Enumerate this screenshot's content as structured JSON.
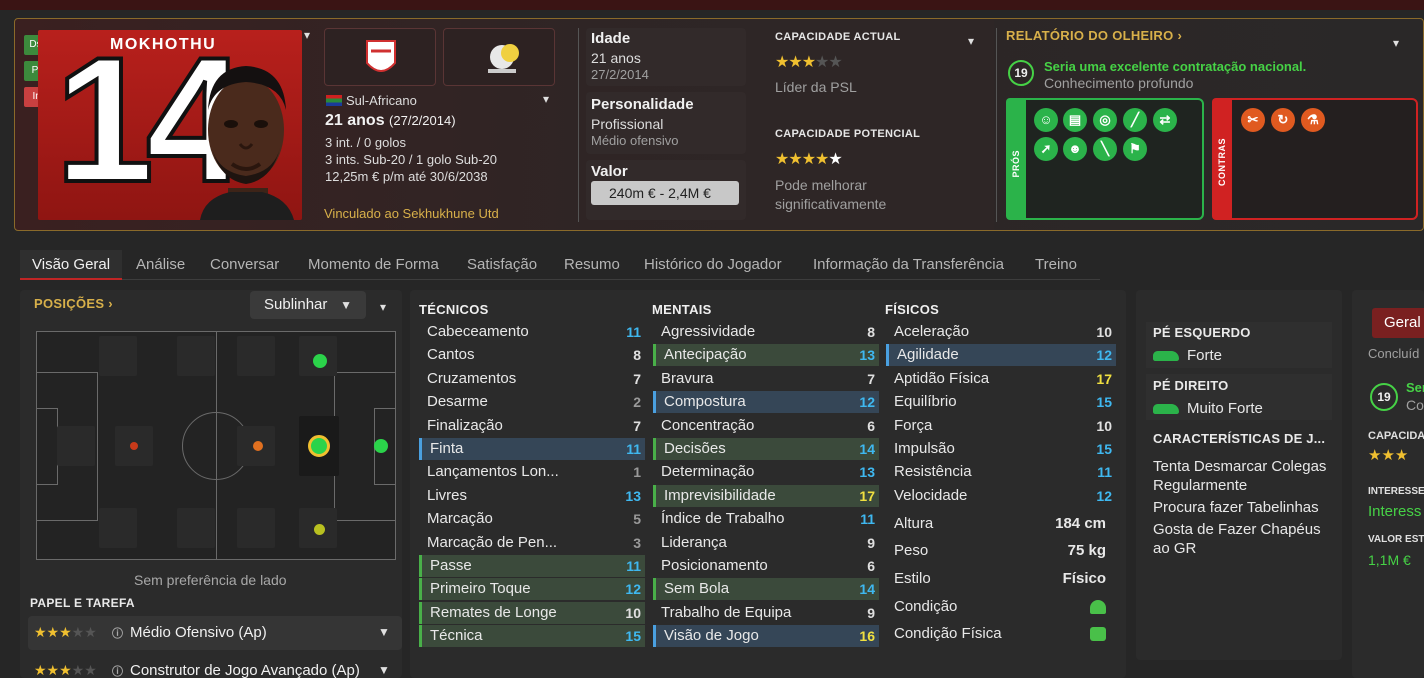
{
  "player": {
    "name": "MOKHOTHU",
    "number": "14",
    "nationality": "Sul-Africano",
    "age_bold": "21 anos",
    "dob_paren": "(27/2/2014)",
    "caps": "3 int. / 0 golos",
    "u20_caps": "3 ints. Sub-20 / 1 golo Sub-20",
    "contract": "12,25m € p/m até 30/6/2038",
    "club_link": "Vinculado ao Sekhukhune Utd"
  },
  "role_buttons": [
    {
      "label": "Dsc",
      "color": "#3c8a3c"
    },
    {
      "label": "Prt",
      "color": "#3c8a3c"
    },
    {
      "label": "Int",
      "color": "#c84040"
    }
  ],
  "info": {
    "age_label": "Idade",
    "age_value": "21 anos",
    "age_dob": "27/2/2014",
    "personality_label": "Personalidade",
    "personality_value": "Profissional",
    "personality_role": "Médio ofensivo",
    "value_label": "Valor",
    "value_range": "240m € - 2,4M €"
  },
  "ability": {
    "current_label": "CAPACIDADE ACTUAL",
    "current_stars": "★★★",
    "current_stars_empty": "★★",
    "current_note": "Líder da PSL",
    "potential_label": "CAPACIDADE POTENCIAL",
    "potential_stars": "★★★★",
    "potential_stars_white": "★",
    "potential_note": "Pode melhorar significativamente"
  },
  "scout": {
    "title": "RELATÓRIO DO OLHEIRO",
    "rating": "19",
    "headline": "Seria uma excelente contratação nacional.",
    "knowledge": "Conhecimento profundo",
    "pros_label": "PRÓS",
    "cons_label": "CONTRAS",
    "pros_icons": [
      "head-icon",
      "clipboard-icon",
      "target-icon",
      "boot-icon",
      "arrows-icon",
      "pass-icon",
      "smile-icon",
      "bandage-icon",
      "flag-icon"
    ],
    "cons_icons": [
      "scissors-icon",
      "curve-icon",
      "flask-icon"
    ]
  },
  "tabs": [
    "Visão Geral",
    "Análise",
    "Conversar",
    "Momento de Forma",
    "Satisfação",
    "Resumo",
    "Histórico do Jogador",
    "Informação da Transferência",
    "Treino"
  ],
  "positions": {
    "title": "POSIÇÕES",
    "dropdown": "Sublinhar",
    "side_pref": "Sem preferência de lado"
  },
  "role": {
    "title": "PAPEL E TAREFA",
    "items": [
      {
        "stars": "★★★",
        "empty": "★★",
        "label": "Médio Ofensivo (Ap)"
      },
      {
        "stars": "★★★",
        "empty": "★★",
        "label": "Construtor de Jogo Avançado (Ap)"
      }
    ]
  },
  "attributes": {
    "technical_title": "TÉCNICOS",
    "mental_title": "MENTAIS",
    "physical_title": "FÍSICOS",
    "technical": [
      {
        "name": "Cabeceamento",
        "value": "11",
        "color": "#3fb8f0",
        "hl": ""
      },
      {
        "name": "Cantos",
        "value": "8",
        "color": "#e0e0e0",
        "hl": ""
      },
      {
        "name": "Cruzamentos",
        "value": "7",
        "color": "#e0e0e0",
        "hl": ""
      },
      {
        "name": "Desarme",
        "value": "2",
        "color": "#9a9a9a",
        "hl": ""
      },
      {
        "name": "Finalização",
        "value": "7",
        "color": "#e0e0e0",
        "hl": ""
      },
      {
        "name": "Finta",
        "value": "11",
        "color": "#3fb8f0",
        "hl": "blue"
      },
      {
        "name": "Lançamentos Lon...",
        "value": "1",
        "color": "#9a9a9a",
        "hl": ""
      },
      {
        "name": "Livres",
        "value": "13",
        "color": "#3fb8f0",
        "hl": ""
      },
      {
        "name": "Marcação",
        "value": "5",
        "color": "#9a9a9a",
        "hl": ""
      },
      {
        "name": "Marcação de Pen...",
        "value": "3",
        "color": "#9a9a9a",
        "hl": ""
      },
      {
        "name": "Passe",
        "value": "11",
        "color": "#3fb8f0",
        "hl": "green"
      },
      {
        "name": "Primeiro Toque",
        "value": "12",
        "color": "#3fb8f0",
        "hl": "green"
      },
      {
        "name": "Remates de Longe",
        "value": "10",
        "color": "#e0e0e0",
        "hl": "green"
      },
      {
        "name": "Técnica",
        "value": "15",
        "color": "#3fb8f0",
        "hl": "green"
      }
    ],
    "mental": [
      {
        "name": "Agressividade",
        "value": "8",
        "color": "#e0e0e0",
        "hl": ""
      },
      {
        "name": "Antecipação",
        "value": "13",
        "color": "#3fb8f0",
        "hl": "green"
      },
      {
        "name": "Bravura",
        "value": "7",
        "color": "#e0e0e0",
        "hl": ""
      },
      {
        "name": "Compostura",
        "value": "12",
        "color": "#3fb8f0",
        "hl": "blue"
      },
      {
        "name": "Concentração",
        "value": "6",
        "color": "#e0e0e0",
        "hl": ""
      },
      {
        "name": "Decisões",
        "value": "14",
        "color": "#3fb8f0",
        "hl": "green"
      },
      {
        "name": "Determinação",
        "value": "13",
        "color": "#3fb8f0",
        "hl": ""
      },
      {
        "name": "Imprevisibilidade",
        "value": "17",
        "color": "#f0e040",
        "hl": "green"
      },
      {
        "name": "Índice de Trabalho",
        "value": "11",
        "color": "#3fb8f0",
        "hl": ""
      },
      {
        "name": "Liderança",
        "value": "9",
        "color": "#e0e0e0",
        "hl": ""
      },
      {
        "name": "Posicionamento",
        "value": "6",
        "color": "#e0e0e0",
        "hl": ""
      },
      {
        "name": "Sem Bola",
        "value": "14",
        "color": "#3fb8f0",
        "hl": "green"
      },
      {
        "name": "Trabalho de Equipa",
        "value": "9",
        "color": "#e0e0e0",
        "hl": ""
      },
      {
        "name": "Visão de Jogo",
        "value": "16",
        "color": "#f0e040",
        "hl": "blue"
      }
    ],
    "physical": [
      {
        "name": "Aceleração",
        "value": "10",
        "color": "#e0e0e0",
        "hl": ""
      },
      {
        "name": "Agilidade",
        "value": "12",
        "color": "#3fb8f0",
        "hl": "blue"
      },
      {
        "name": "Aptidão Física",
        "value": "17",
        "color": "#f0e040",
        "hl": ""
      },
      {
        "name": "Equilíbrio",
        "value": "15",
        "color": "#3fb8f0",
        "hl": ""
      },
      {
        "name": "Força",
        "value": "10",
        "color": "#e0e0e0",
        "hl": ""
      },
      {
        "name": "Impulsão",
        "value": "15",
        "color": "#3fb8f0",
        "hl": ""
      },
      {
        "name": "Resistência",
        "value": "11",
        "color": "#3fb8f0",
        "hl": ""
      },
      {
        "name": "Velocidade",
        "value": "12",
        "color": "#3fb8f0",
        "hl": ""
      }
    ],
    "extra": [
      {
        "name": "Altura",
        "value": "184 cm"
      },
      {
        "name": "Peso",
        "value": "75 kg"
      },
      {
        "name": "Estilo",
        "value": "Físico"
      },
      {
        "name": "Condição",
        "value": ""
      },
      {
        "name": "Condição Física",
        "value": ""
      }
    ]
  },
  "feet": {
    "left_label": "PÉ ESQUERDO",
    "left_value": "Forte",
    "right_label": "PÉ DIREITO",
    "right_value": "Muito Forte",
    "traits_label": "CARACTERÍSTICAS DE J...",
    "traits": [
      "Tenta Desmarcar Colegas Regularmente",
      "Procura fazer Tabelinhas",
      "Gosta de Fazer Chapéus ao GR"
    ]
  },
  "right_panel": {
    "button": "Geral",
    "concluded": "Concluíd",
    "rating": "19",
    "line1": "Ser",
    "line2": "Co",
    "capacity": "CAPACIDA",
    "stars": "★★★",
    "interest_label": "INTERESSE",
    "interest_value": "Interess",
    "value_label": "VALOR EST",
    "value": "1,1M €"
  }
}
